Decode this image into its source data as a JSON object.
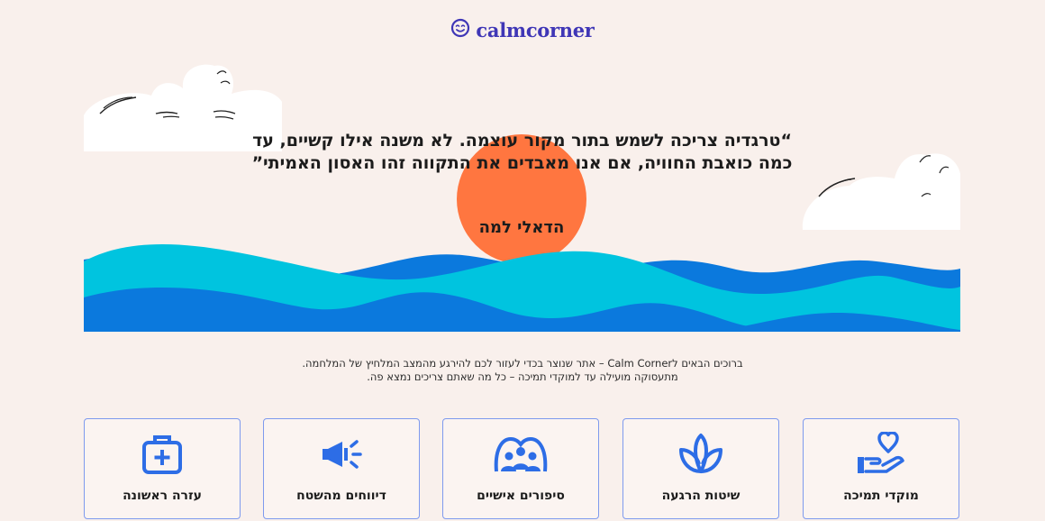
{
  "logo": {
    "text": "calmcorner",
    "icon": "smiley-face-icon"
  },
  "hero": {
    "quote": "“טרגדיה צריכה לשמש בתור מקור עוצמה. לא משנה אילו קשיים, עד כמה כואבת החוויה, אם אנו מאבדים את התקווה זהו האסון האמיתי”",
    "author": "הדאלי למה"
  },
  "intro": {
    "line1": "ברוכים הבאים לCalm Corner – אתר שנוצר בכדי לעזור לכם להירגע מהמצב המלחיץ של המלחמה.",
    "line2": "מתעסוקה מועילה עד למוקדי תמיכה – כל מה שאתם צריכים נמצא פה."
  },
  "cards": [
    {
      "label": "עזרה ראשונה",
      "icon": "first-aid-kit-icon"
    },
    {
      "label": "דיווחים מהשטח",
      "icon": "megaphone-icon"
    },
    {
      "label": "סיפורים אישיים",
      "icon": "people-group-icon"
    },
    {
      "label": "שיטות הרגעה",
      "icon": "lotus-icon"
    },
    {
      "label": "מוקדי תמיכה",
      "icon": "heart-hand-icon"
    }
  ],
  "colors": {
    "background": "#f9f0ec",
    "brand": "#3f36b6",
    "sun": "#ff7640",
    "wave_light": "#00c4df",
    "wave_dark": "#0b79dd",
    "icon_blue": "#2d6de6",
    "card_border": "#7e9aee"
  }
}
